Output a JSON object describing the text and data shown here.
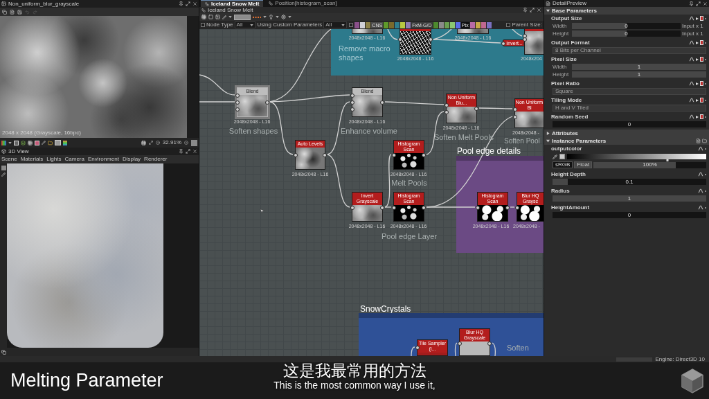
{
  "preview_2d": {
    "title": "Non_uniform_blur_grayscale",
    "image_info": "2048 x 2048 (Grayscale, 16bpc)",
    "zoom": "32.91%"
  },
  "view_3d": {
    "title": "3D View",
    "menu": [
      "Scene",
      "Materials",
      "Lights",
      "Camera",
      "Environment",
      "Display",
      "Renderer"
    ]
  },
  "graph": {
    "tabs": [
      {
        "label": "Iceland Snow Melt",
        "selected": true
      },
      {
        "label": "Position[histogram_scan]",
        "selected": false
      }
    ],
    "breadcrumb": "Iceland Snow Melt",
    "filters": [
      {
        "label": "Node Type",
        "value": "All",
        "checked": false
      },
      {
        "label": "Using Custom Parameters",
        "value": "All"
      }
    ],
    "tags_filter_checked": false,
    "tags": [
      {
        "color": "#8a4f8a"
      },
      {
        "color": "#d0d0d8"
      },
      {
        "color": "#8c8048"
      },
      {
        "color": "#4a4a4a",
        "label": "CNS"
      },
      {
        "color": "#5f9a2a"
      },
      {
        "color": "#7b6a2c"
      },
      {
        "color": "#2f7d8e"
      },
      {
        "color": "#b8c840"
      },
      {
        "color": "#8d7cb0"
      },
      {
        "color": "#3a3a3a",
        "label": "FxM-G/D"
      },
      {
        "color": "#4d8a2e"
      },
      {
        "color": "#8a8a8a"
      },
      {
        "color": "#6aa050"
      },
      {
        "color": "#8cc870"
      },
      {
        "color": "#5a6ee8"
      },
      {
        "color": "#101010",
        "label": "Ptx"
      },
      {
        "color": "#b86aa8"
      },
      {
        "color": "#c8a848"
      },
      {
        "color": "#c06890"
      },
      {
        "color": "#7a70c0"
      }
    ],
    "parent_size": {
      "label": "Parent Size:",
      "checked": false
    },
    "frames": [
      {
        "color": "#2d7a8c"
      },
      {
        "title": "Pool edge details",
        "color": "#6b4a84"
      },
      {
        "title": "SnowCrystals",
        "color": "#2f5197"
      }
    ],
    "nodes": [
      {
        "kind": "atomic",
        "info": "2048x2048 - L16",
        "selected": false
      },
      {
        "kind": "instance",
        "info": "2048x2048 - L16",
        "selected": false
      },
      {
        "kind": "atomic",
        "info": "2048x2048 - L16",
        "selected": false
      },
      {
        "kind": "compact",
        "title": "Invert...",
        "selected": false
      },
      {
        "kind": "instance",
        "info": "2048x204",
        "selected": false
      },
      {
        "kind": "atomic",
        "title": "Blend",
        "info": "2048x2048 - L16",
        "selected": true
      },
      {
        "kind": "atomic",
        "title": "Blend",
        "info": "2048x2048 - L16",
        "selected": false
      },
      {
        "kind": "instance",
        "title": "Non Uniform Blu...",
        "info": "2048x2048 - L16",
        "selected": false
      },
      {
        "kind": "instance",
        "title": "Non Uniform Bl",
        "info": "2048x2048 -",
        "selected": false
      },
      {
        "kind": "instance",
        "title": "Auto Levels",
        "info": "2048x2048 - L16",
        "selected": false
      },
      {
        "kind": "instance",
        "title": "Histogram Scan",
        "info": "2048x2048 - L16",
        "selected": false
      },
      {
        "kind": "instance",
        "title": "Invert Grayscale",
        "info": "2048x2048 - L16",
        "selected": false
      },
      {
        "kind": "instance",
        "title": "Histogram Scan",
        "info": "2048x2048 - L16",
        "selected": false
      },
      {
        "kind": "instance",
        "title": "Histogram Scan",
        "info": "2048x2048 - L16",
        "selected": false
      },
      {
        "kind": "instance",
        "title": "Blur HQ Graysc",
        "info": "2048x2048 -",
        "selected": false
      },
      {
        "kind": "instance",
        "title": "Tile Sampler (I...",
        "selected": false
      },
      {
        "kind": "instance",
        "title": "Blur HQ Grayscale",
        "selected": false
      }
    ],
    "comments": [
      "Remove macro shapes",
      "Soften shapes",
      "Enhance volume",
      "Soften Melt Pools",
      "Soften Pool",
      "Melt Pools",
      "Pool edge Layer",
      "Soften"
    ]
  },
  "parameters": {
    "title": "DetailPreview",
    "sections": [
      {
        "title": "Base Parameters",
        "expanded": true,
        "groups": [
          {
            "label": "Output Size",
            "rows": [
              {
                "kind": "slider",
                "label": "Width",
                "value": "0",
                "level": 0.5,
                "suffix": "Input x 1"
              },
              {
                "kind": "slider",
                "label": "Height",
                "value": "0",
                "level": 0.5,
                "suffix": "Input x 1"
              }
            ]
          },
          {
            "label": "Output Format",
            "rows": [
              {
                "kind": "dropdown",
                "value": "8 Bits per Channel",
                "disabled": true
              }
            ]
          },
          {
            "label": "Pixel Size",
            "rows": [
              {
                "kind": "slider",
                "label": "Width",
                "value": "1",
                "level": 1
              },
              {
                "kind": "slider",
                "label": "Height",
                "value": "1",
                "level": 1
              }
            ]
          },
          {
            "label": "Pixel Ratio",
            "rows": [
              {
                "kind": "dropdown",
                "value": "Square",
                "disabled": true
              }
            ]
          },
          {
            "label": "Tiling Mode",
            "rows": [
              {
                "kind": "dropdown",
                "value": "H and V Tiled",
                "disabled": true
              }
            ]
          },
          {
            "label": "Random Seed",
            "rows": [
              {
                "kind": "number",
                "value": "0"
              }
            ]
          }
        ]
      },
      {
        "title": "Attributes",
        "expanded": false
      },
      {
        "title": "Instance Parameters",
        "expanded": true,
        "groups": [
          {
            "label": "outputcolor",
            "rows": [
              {
                "kind": "gradient",
                "level": 0.72
              },
              {
                "kind": "color",
                "modes": [
                  {
                    "label": "sRGB",
                    "selected": true
                  },
                  {
                    "label": "Float",
                    "selected": false
                  }
                ],
                "value": "100%",
                "level": 0.73
              }
            ]
          },
          {
            "label": "Height Depth",
            "rows": [
              {
                "kind": "slider",
                "value": "0.1",
                "level": 0.1
              }
            ]
          },
          {
            "label": "Radius",
            "rows": [
              {
                "kind": "slider",
                "value": "1",
                "level": 1
              }
            ]
          },
          {
            "label": "HeightAmount",
            "rows": [
              {
                "kind": "number",
                "value": "0"
              }
            ]
          }
        ]
      }
    ]
  },
  "status_bar": {
    "engine": "Engine: Direct3D 10"
  },
  "caption": {
    "title": "Melting Parameter",
    "subtitle_zh": "这是我最常用的方法",
    "subtitle_en": "This is the most common way I use it,"
  }
}
